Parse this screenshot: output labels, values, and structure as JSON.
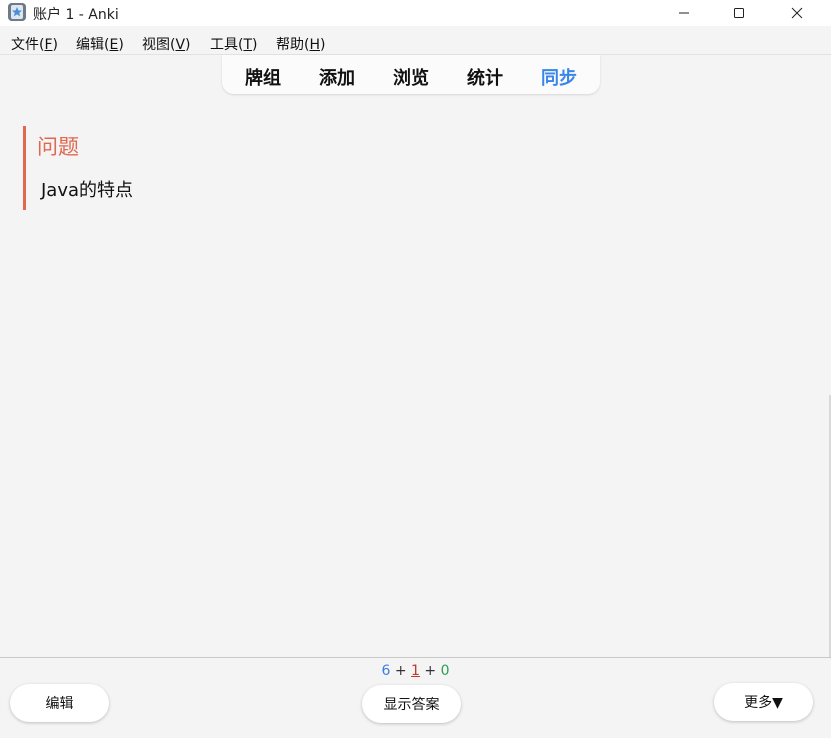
{
  "window": {
    "title": "账户 1 - Anki",
    "controls": [
      "minimize-icon",
      "maximize-icon",
      "close-icon"
    ]
  },
  "menu": [
    {
      "label": "文件(",
      "accel": "F",
      "end": ")"
    },
    {
      "label": "编辑(",
      "accel": "E",
      "end": ")"
    },
    {
      "label": "视图(",
      "accel": "V",
      "end": ")"
    },
    {
      "label": "工具(",
      "accel": "T",
      "end": ")"
    },
    {
      "label": "帮助(",
      "accel": "H",
      "end": ")"
    }
  ],
  "toolbar": {
    "tabs": [
      "牌组",
      "添加",
      "浏览",
      "统计",
      "同步"
    ],
    "active": "同步",
    "active_color": "#3a86e8"
  },
  "card": {
    "heading": "问题",
    "question": "Java的特点",
    "accent_color": "#e06850"
  },
  "counts": {
    "new": "6",
    "learning": "1",
    "review": "0",
    "sep": "+"
  },
  "buttons": {
    "edit": "编辑",
    "show_answer": "显示答案",
    "more": "更多▼"
  }
}
